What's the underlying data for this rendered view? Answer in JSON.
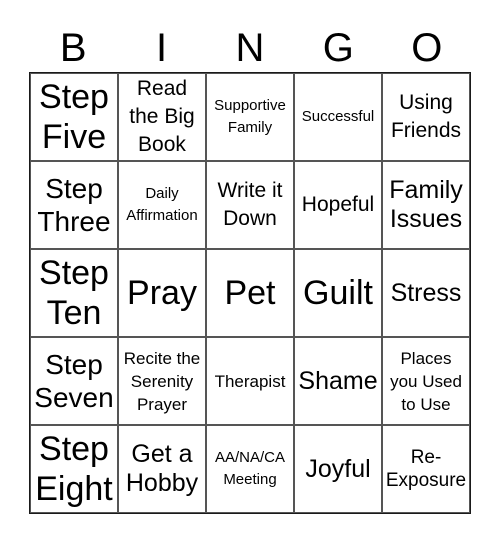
{
  "header": [
    "B",
    "I",
    "N",
    "G",
    "O"
  ],
  "rows": [
    [
      "Step Five",
      "Read the Big Book",
      "Supportive Family",
      "Successful",
      "Using Friends"
    ],
    [
      "Step Three",
      "Daily Affirmation",
      "Write it Down",
      "Hopeful",
      "Family Issues"
    ],
    [
      "Step Ten",
      "Pray",
      "Pet",
      "Guilt",
      "Stress"
    ],
    [
      "Step Seven",
      "Recite the Serenity Prayer",
      "Therapist",
      "Shame",
      "Places you Used to Use"
    ],
    [
      "Step Eight",
      "Get a Hobby",
      "AA/NA/CA Meeting",
      "Joyful",
      "Re-Exposure"
    ]
  ],
  "rows_display": [
    [
      [
        "Step",
        "Five"
      ],
      [
        "Read",
        "the Big",
        "Book"
      ],
      [
        "Supportive",
        "Family"
      ],
      [
        "Successful"
      ],
      [
        "Using",
        "Friends"
      ]
    ],
    [
      [
        "Step",
        "Three"
      ],
      [
        "Daily",
        "Affirmation"
      ],
      [
        "Write it",
        "Down"
      ],
      [
        "Hopeful"
      ],
      [
        "Family",
        "Issues"
      ]
    ],
    [
      [
        "Step",
        "Ten"
      ],
      [
        "Pray"
      ],
      [
        "Pet"
      ],
      [
        "Guilt"
      ],
      [
        "Stress"
      ]
    ],
    [
      [
        "Step",
        "Seven"
      ],
      [
        "Recite the",
        "Serenity",
        "Prayer"
      ],
      [
        "Therapist"
      ],
      [
        "Shame"
      ],
      [
        "Places",
        "you Used",
        "to Use"
      ]
    ],
    [
      [
        "Step",
        "Eight"
      ],
      [
        "Get a",
        "Hobby"
      ],
      [
        "AA/NA/CA",
        "Meeting"
      ],
      [
        "Joyful"
      ],
      [
        "Re-",
        "Exposure"
      ]
    ]
  ]
}
